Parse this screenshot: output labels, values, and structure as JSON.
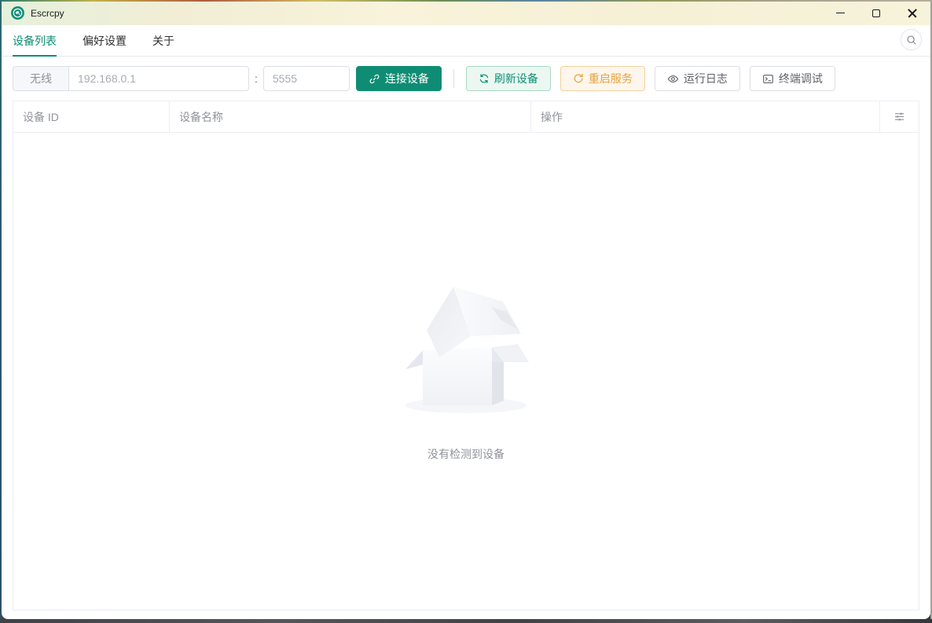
{
  "window": {
    "title": "Escrcpy"
  },
  "tabs": {
    "items": [
      {
        "label": "设备列表",
        "active": true
      },
      {
        "label": "偏好设置",
        "active": false
      },
      {
        "label": "关于",
        "active": false
      }
    ]
  },
  "toolbar": {
    "wireless_label": "无线",
    "ip_placeholder": "192.168.0.1",
    "port_separator": ":",
    "port_placeholder": "5555",
    "connect_label": "连接设备",
    "refresh_label": "刷新设备",
    "restart_label": "重启服务",
    "log_label": "运行日志",
    "terminal_label": "终端调试"
  },
  "table": {
    "columns": [
      {
        "label": "设备 ID"
      },
      {
        "label": "设备名称"
      },
      {
        "label": "操作"
      }
    ],
    "empty_text": "没有检测到设备"
  },
  "colors": {
    "primary": "#0f8d74",
    "warning": "#e6a23c",
    "border": "#dcdfe6",
    "table_border": "#ebeef5",
    "header_text": "#909399",
    "titlebar_gradient_left": "#e5f1dc",
    "titlebar_gradient_right": "#f7f3da"
  }
}
